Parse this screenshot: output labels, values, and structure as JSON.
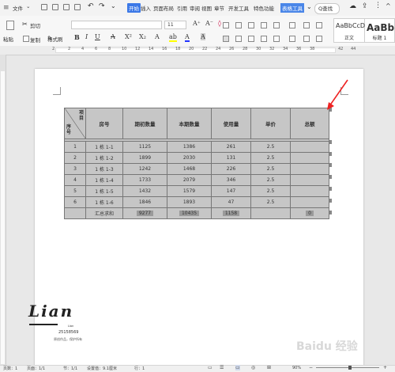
{
  "menubar": {
    "file_label": "文件",
    "tabs": [
      "开始",
      "插入",
      "页面布局",
      "引用",
      "审阅",
      "视图",
      "章节",
      "开发工具",
      "特色功能",
      "表格工具"
    ],
    "search_label": "Q查找"
  },
  "ribbon": {
    "cut_label": "剪切",
    "paste_label": "粘贴",
    "copy_label": "复制",
    "format_painter_label": "格式刷",
    "font_size_value": "11",
    "style_samples": [
      {
        "sample": "AaBbCcD",
        "label": "正文"
      },
      {
        "sample": "AaBb",
        "label": "标题 1"
      }
    ]
  },
  "ruler": {
    "marks": [
      "2",
      "2",
      "4",
      "6",
      "8",
      "10",
      "12",
      "14",
      "16",
      "18",
      "20",
      "22",
      "24",
      "26",
      "28",
      "30",
      "32",
      "34",
      "36",
      "38",
      "42",
      "44"
    ]
  },
  "table": {
    "header": {
      "diag_top": "项\n目",
      "diag_bottom": "序\n号",
      "cols": [
        "房号",
        "期初数量",
        "本期数量",
        "使用量",
        "单价",
        "总额"
      ]
    },
    "rows": [
      [
        "1",
        "1 栋 1-1",
        "1125",
        "1386",
        "261",
        "2.5",
        ""
      ],
      [
        "2",
        "1 栋 1-2",
        "1899",
        "2030",
        "131",
        "2.5",
        ""
      ],
      [
        "3",
        "1 栋 1-3",
        "1242",
        "1468",
        "226",
        "2.5",
        ""
      ],
      [
        "4",
        "1 栋 1-4",
        "1733",
        "2079",
        "346",
        "2.5",
        ""
      ],
      [
        "5",
        "1 栋 1-5",
        "1432",
        "1579",
        "147",
        "2.5",
        ""
      ],
      [
        "6",
        "1 栋 1-6",
        "1846",
        "1893",
        "47",
        "2.5",
        ""
      ]
    ],
    "summary": [
      "",
      "汇总求和",
      "9277",
      "10435",
      "1158",
      "",
      "0"
    ]
  },
  "watermark": {
    "logo": "Lian",
    "small": "Lian",
    "number": "25158569",
    "tagline": "原创作品，保护所有"
  },
  "baidu_watermark": "Baidu 经验",
  "status": {
    "words": "页数：1",
    "page": "页面：1/1",
    "section": "节：1/1",
    "setting": "设置值：9.1厘米",
    "row": "行：1",
    "zoom": "90%"
  }
}
